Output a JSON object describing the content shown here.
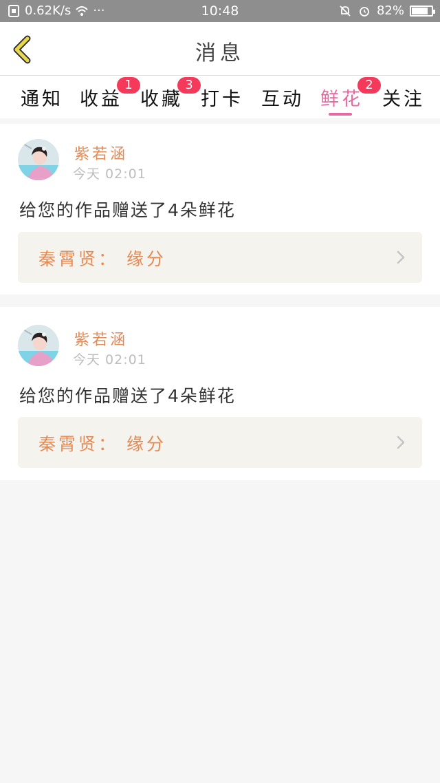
{
  "status_bar": {
    "network_speed": "0.62K/s",
    "more": "···",
    "time": "10:48",
    "battery_text": "82%",
    "battery_level": 0.82
  },
  "header": {
    "title": "消息",
    "back_icon": "chevron-left-icon"
  },
  "tabs": [
    {
      "label": "通知",
      "badge": ""
    },
    {
      "label": "收益",
      "badge": "1"
    },
    {
      "label": "收藏",
      "badge": "3"
    },
    {
      "label": "打卡",
      "badge": ""
    },
    {
      "label": "互动",
      "badge": ""
    },
    {
      "label": "鲜花",
      "badge": "2",
      "active": true
    },
    {
      "label": "关注",
      "badge": ""
    }
  ],
  "messages": [
    {
      "username": "紫若涵",
      "time": "今天 02:01",
      "text": "给您的作品赠送了4朵鲜花",
      "work_title": "秦霄贤： 缘分"
    },
    {
      "username": "紫若涵",
      "time": "今天 02:01",
      "text": "给您的作品赠送了4朵鲜花",
      "work_title": "秦霄贤： 缘分"
    }
  ],
  "colors": {
    "accent_pink": "#e66aa0",
    "accent_orange": "#e48a55",
    "badge_red": "#f4395a",
    "back_arrow": "#e8d84a"
  }
}
